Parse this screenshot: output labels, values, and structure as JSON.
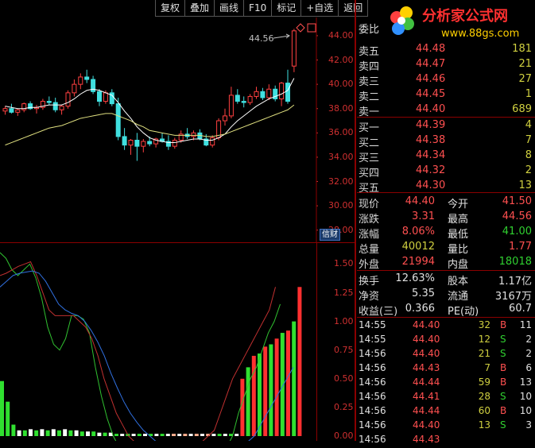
{
  "toolbar": [
    "复权",
    "叠加",
    "画线",
    "F10",
    "标记",
    "+自选",
    "返回"
  ],
  "logo": {
    "name": "分析家公式网",
    "url": "www.88gs.com"
  },
  "price_axis": [
    "44.00",
    "42.00",
    "40.00",
    "38.00",
    "36.00",
    "34.00",
    "32.00",
    "30.00",
    "28.00"
  ],
  "ind_axis": [
    "1.50",
    "1.25",
    "1.00",
    "0.75",
    "0.50",
    "0.25",
    "0.00"
  ],
  "high_marker": "44.56",
  "badge": "信财",
  "order_book": {
    "header": "委比",
    "asks": [
      {
        "label": "卖五",
        "price": "44.48",
        "vol": "181"
      },
      {
        "label": "卖四",
        "price": "44.47",
        "vol": "21"
      },
      {
        "label": "卖三",
        "price": "44.46",
        "vol": "27"
      },
      {
        "label": "卖二",
        "price": "44.45",
        "vol": "1"
      },
      {
        "label": "卖一",
        "price": "44.40",
        "vol": "689"
      }
    ],
    "bids": [
      {
        "label": "买一",
        "price": "44.39",
        "vol": "4"
      },
      {
        "label": "买二",
        "price": "44.38",
        "vol": "7"
      },
      {
        "label": "买三",
        "price": "44.34",
        "vol": "8"
      },
      {
        "label": "买四",
        "price": "44.32",
        "vol": "2"
      },
      {
        "label": "买五",
        "price": "44.30",
        "vol": "13"
      }
    ]
  },
  "stats": [
    {
      "l1": "现价",
      "v1": "44.40",
      "c1": "red",
      "l2": "今开",
      "v2": "41.50",
      "c2": "red"
    },
    {
      "l1": "涨跌",
      "v1": "3.31",
      "c1": "red",
      "l2": "最高",
      "v2": "44.56",
      "c2": "red"
    },
    {
      "l1": "涨幅",
      "v1": "8.06%",
      "c1": "red",
      "l2": "最低",
      "v2": "41.00",
      "c2": "green"
    },
    {
      "l1": "总量",
      "v1": "40012",
      "c1": "yellow",
      "l2": "量比",
      "v2": "1.77",
      "c2": "red"
    },
    {
      "l1": "外盘",
      "v1": "21994",
      "c1": "red",
      "l2": "内盘",
      "v2": "18018",
      "c2": "green"
    }
  ],
  "fund": [
    {
      "l1": "换手",
      "v1": "12.63%",
      "l2": "股本",
      "v2": "1.17亿"
    },
    {
      "l1": "净资",
      "v1": "5.35",
      "l2": "流通",
      "v2": "3167万"
    },
    {
      "l1": "收益(三)",
      "v1": "0.366",
      "l2": "PE(动)",
      "v2": "60.7"
    }
  ],
  "ticks": [
    {
      "t": "14:55",
      "p": "44.40",
      "v": "32",
      "s": "B",
      "n": "11"
    },
    {
      "t": "14:55",
      "p": "44.40",
      "v": "12",
      "s": "S",
      "n": "2"
    },
    {
      "t": "14:56",
      "p": "44.40",
      "v": "21",
      "s": "S",
      "n": "2"
    },
    {
      "t": "14:56",
      "p": "44.43",
      "v": "7",
      "s": "B",
      "n": "6"
    },
    {
      "t": "14:56",
      "p": "44.44",
      "v": "59",
      "s": "B",
      "n": "13"
    },
    {
      "t": "14:56",
      "p": "44.41",
      "v": "28",
      "s": "S",
      "n": "10"
    },
    {
      "t": "14:56",
      "p": "44.44",
      "v": "60",
      "s": "B",
      "n": "10"
    },
    {
      "t": "14:56",
      "p": "44.40",
      "v": "13",
      "s": "S",
      "n": "3"
    },
    {
      "t": "14:56",
      "p": "44.43",
      "v": "",
      "s": "",
      "n": ""
    }
  ],
  "chart_data": {
    "type": "candlestick",
    "y_range": [
      27,
      45.5
    ],
    "candles": [
      [
        37.8,
        38.2,
        37.5,
        38.0
      ],
      [
        38.0,
        38.4,
        37.6,
        37.7
      ],
      [
        37.7,
        38.0,
        37.4,
        37.9
      ],
      [
        37.9,
        38.5,
        37.7,
        38.4
      ],
      [
        38.4,
        38.6,
        37.9,
        38.0
      ],
      [
        38.0,
        38.3,
        37.6,
        38.1
      ],
      [
        38.1,
        38.8,
        37.9,
        38.6
      ],
      [
        38.6,
        39.0,
        38.3,
        38.5
      ],
      [
        38.5,
        38.9,
        37.7,
        37.9
      ],
      [
        37.9,
        38.3,
        37.5,
        38.2
      ],
      [
        38.2,
        39.5,
        38.0,
        39.3
      ],
      [
        39.3,
        40.4,
        39.0,
        40.0
      ],
      [
        40.0,
        40.9,
        39.6,
        40.6
      ],
      [
        40.6,
        41.2,
        40.1,
        40.4
      ],
      [
        40.4,
        40.7,
        39.2,
        39.4
      ],
      [
        39.4,
        39.6,
        38.2,
        38.6
      ],
      [
        38.6,
        39.5,
        38.4,
        39.3
      ],
      [
        39.3,
        39.6,
        38.2,
        38.4
      ],
      [
        38.4,
        38.9,
        35.4,
        35.7
      ],
      [
        35.7,
        36.4,
        34.6,
        35.0
      ],
      [
        35.0,
        35.5,
        34.2,
        35.4
      ],
      [
        35.4,
        36.0,
        33.7,
        34.9
      ],
      [
        34.9,
        35.5,
        34.4,
        35.3
      ],
      [
        35.3,
        35.7,
        34.9,
        35.1
      ],
      [
        35.1,
        35.6,
        34.8,
        35.5
      ],
      [
        35.5,
        36.0,
        35.2,
        35.3
      ],
      [
        35.3,
        35.8,
        34.6,
        34.9
      ],
      [
        34.9,
        35.6,
        34.7,
        35.4
      ],
      [
        35.4,
        36.2,
        35.2,
        35.9
      ],
      [
        35.9,
        36.4,
        35.5,
        35.7
      ],
      [
        35.7,
        36.2,
        35.4,
        36.0
      ],
      [
        36.0,
        36.3,
        35.4,
        35.5
      ],
      [
        35.5,
        35.9,
        34.9,
        35.0
      ],
      [
        35.0,
        35.8,
        34.8,
        35.6
      ],
      [
        35.6,
        37.2,
        35.4,
        37.0
      ],
      [
        37.0,
        38.0,
        36.6,
        37.4
      ],
      [
        37.4,
        39.8,
        37.2,
        39.1
      ],
      [
        39.1,
        39.6,
        38.4,
        38.6
      ],
      [
        38.6,
        39.0,
        38.1,
        38.5
      ],
      [
        38.5,
        39.2,
        38.3,
        39.0
      ],
      [
        39.0,
        39.8,
        38.8,
        39.4
      ],
      [
        39.4,
        39.7,
        38.7,
        38.9
      ],
      [
        38.9,
        40.0,
        38.7,
        39.6
      ],
      [
        39.6,
        39.9,
        38.6,
        38.8
      ],
      [
        38.8,
        40.2,
        38.2,
        40.1
      ],
      [
        40.1,
        41.2,
        38.4,
        38.6
      ],
      [
        41.5,
        44.56,
        41.0,
        44.4
      ]
    ],
    "ma_white": [
      38.2,
      38.1,
      38.0,
      38.0,
      38.1,
      38.1,
      38.2,
      38.3,
      38.3,
      38.3,
      38.5,
      38.8,
      39.2,
      39.5,
      39.6,
      39.5,
      39.3,
      39.1,
      38.5,
      37.8,
      37.2,
      36.5,
      36.0,
      35.6,
      35.4,
      35.3,
      35.2,
      35.2,
      35.3,
      35.4,
      35.5,
      35.5,
      35.4,
      35.4,
      35.6,
      35.9,
      36.5,
      37.0,
      37.4,
      37.8,
      38.2,
      38.5,
      38.8,
      39.0,
      39.2,
      39.5,
      40.5
    ],
    "ma_yellow": [
      35.0,
      35.2,
      35.4,
      35.6,
      35.8,
      36.0,
      36.2,
      36.4,
      36.5,
      36.6,
      36.8,
      37.0,
      37.2,
      37.3,
      37.4,
      37.5,
      37.6,
      37.6,
      37.4,
      37.2,
      37.0,
      36.7,
      36.5,
      36.2,
      36.1,
      36.0,
      35.9,
      35.8,
      35.8,
      35.8,
      35.8,
      35.8,
      35.7,
      35.7,
      35.8,
      35.9,
      36.1,
      36.3,
      36.5,
      36.7,
      36.9,
      37.1,
      37.3,
      37.5,
      37.7,
      37.9,
      38.3
    ],
    "indicator": {
      "y_range": [
        0,
        1.6
      ],
      "bars": [
        0.48,
        0.3,
        0.1,
        0.05,
        0.05,
        0.06,
        0.05,
        0.06,
        0.05,
        0.06,
        0.05,
        0.06,
        0.05,
        0.05,
        0.04,
        0.04,
        0.04,
        0.03,
        0.03,
        0.03,
        0.02,
        0.02,
        0.02,
        0.02,
        0.02,
        0.02,
        0.02,
        0.02,
        0.02,
        0.02,
        0.02,
        0.02,
        0.02,
        0.02,
        0.02,
        0.02,
        0.02,
        0.02,
        0.02,
        0.02,
        0.02,
        0.02,
        0.5,
        0.6,
        0.7,
        0.72,
        0.78,
        0.8,
        0.85,
        0.9,
        0.92,
        1.0,
        1.3
      ],
      "line_green": [
        1.6,
        1.55,
        1.45,
        1.4,
        1.45,
        1.5,
        1.38,
        1.2,
        0.95,
        0.8,
        0.75,
        0.85,
        1.05,
        1.05,
        1.02,
        0.9,
        0.6,
        0.35,
        0.15,
        0.0,
        -0.1,
        -0.15,
        -0.2,
        -0.2,
        -0.2,
        -0.2,
        -0.2,
        -0.2,
        -0.2,
        -0.2,
        -0.2,
        -0.2,
        -0.2,
        -0.2,
        -0.2,
        -0.2,
        -0.2,
        -0.2,
        -0.1,
        0.0,
        0.2,
        0.35,
        0.5,
        0.6,
        0.75,
        0.9,
        1.0,
        1.15
      ],
      "line_red": [
        1.4,
        1.42,
        1.45,
        1.48,
        1.5,
        1.52,
        1.4,
        1.25,
        1.1,
        1.05,
        1.05,
        1.05,
        1.05,
        1.0,
        0.95,
        0.85,
        0.7,
        0.5,
        0.35,
        0.2,
        0.1,
        0.0,
        -0.05,
        -0.1,
        -0.1,
        -0.1,
        -0.1,
        -0.1,
        -0.1,
        -0.1,
        -0.1,
        -0.1,
        -0.1,
        -0.05,
        0.0,
        0.05,
        0.2,
        0.35,
        0.5,
        0.6,
        0.7,
        0.8,
        0.9,
        1.0,
        1.1,
        1.3
      ],
      "line_blue": [
        1.3,
        1.35,
        1.4,
        1.42,
        1.43,
        1.44,
        1.42,
        1.35,
        1.25,
        1.15,
        1.1,
        1.07,
        1.05,
        1.0,
        0.92,
        0.82,
        0.7,
        0.55,
        0.42,
        0.3,
        0.2,
        0.12,
        0.05,
        0.0,
        -0.05,
        -0.08,
        -0.1,
        -0.1,
        -0.1,
        -0.1,
        -0.1,
        -0.1,
        -0.1,
        -0.1,
        -0.1,
        -0.1,
        -0.1,
        -0.1,
        -0.05,
        0.0,
        0.1,
        0.2,
        0.3,
        0.4,
        0.5,
        0.6
      ]
    }
  }
}
